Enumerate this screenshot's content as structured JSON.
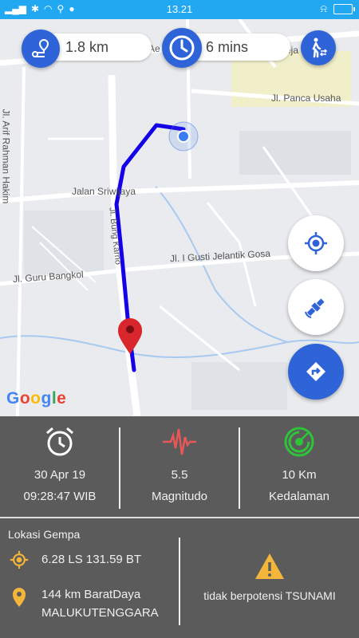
{
  "status_bar": {
    "time": "13.21"
  },
  "map": {
    "distance": "1.8 km",
    "duration": "6 mins",
    "streets": {
      "arif": "Jl. Arif Rahman Hakim",
      "panca": "Jl. Panca Usaha",
      "sriwijaya": "Jalan Sriwijaya",
      "bung_karno": "Jl. Bung Karno",
      "gusti": "Jl. I Gusti Jelantik Gosa",
      "guru": "Jl. Guru Bangkol",
      "top_partial_left": "Ae",
      "top_partial_right": "eja"
    },
    "logo": "Google"
  },
  "info": {
    "date": "30 Apr 19",
    "time": "09:28:47 WIB",
    "magnitude_value": "5.5",
    "magnitude_label": "Magnitudo",
    "depth_value": "10 Km",
    "depth_label": "Kedalaman",
    "location_title": "Lokasi Gempa",
    "coordinates": "6.28 LS 131.59 BT",
    "place_line1": "144 km BaratDaya",
    "place_line2": "MALUKUTENGGARA",
    "tsunami": "tidak berpotensi TSUNAMI"
  },
  "colors": {
    "status_bar": "#21a8f0",
    "route": "#1400e8",
    "button_blue": "#2e64d8",
    "panel_bg": "#5b5b5b",
    "seismo_red": "#e8575a",
    "radar_green": "#2ec43a",
    "marker_yellow": "#f3b53a",
    "marker_red": "#d9262c"
  }
}
